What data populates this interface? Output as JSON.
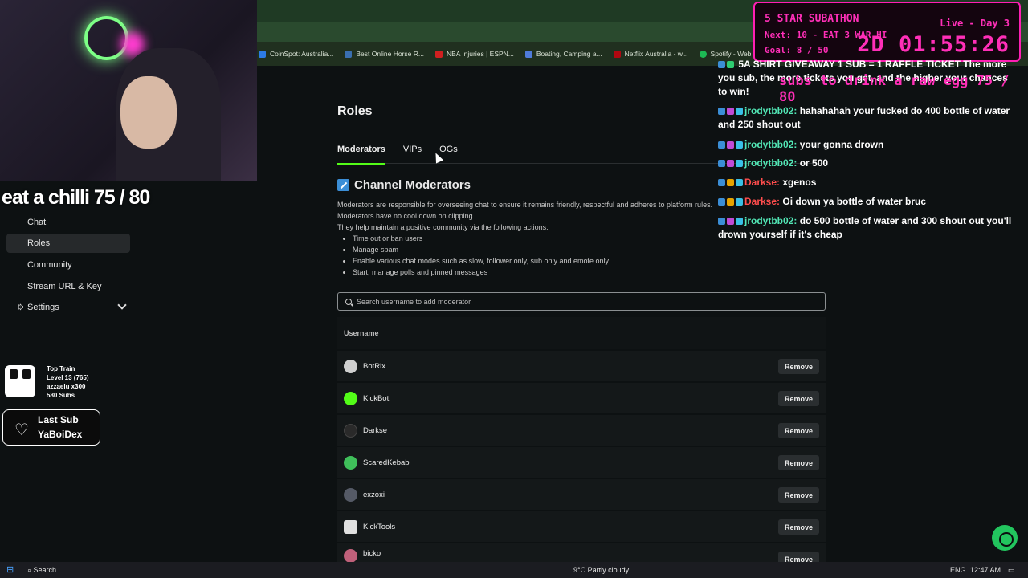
{
  "bookmarks": [
    "CoinSpot: Australia...",
    "Best Online Horse R...",
    "NBA Injuries | ESPN...",
    "Boating, Camping a...",
    "Netflix Australia - w...",
    "Spotify - Web Playe..."
  ],
  "sidebar": {
    "items": [
      {
        "label": "Chat",
        "icon": "none",
        "active": false
      },
      {
        "label": "Roles",
        "icon": "none",
        "active": true
      },
      {
        "label": "Community",
        "icon": "none",
        "active": false
      },
      {
        "label": "Stream URL & Key",
        "icon": "none",
        "active": false
      },
      {
        "label": "Settings",
        "icon": "gear-icon",
        "active": false
      }
    ]
  },
  "main": {
    "title": "Roles",
    "tabs": [
      "Moderators",
      "VIPs",
      "OGs"
    ],
    "active_tab": "Moderators",
    "section_title": "Channel Moderators",
    "desc_line1": "Moderators are responsible for overseeing chat to ensure it remains friendly, respectful and adheres to platform rules.",
    "desc_line2": "Moderators have no cool down on clipping.",
    "desc_line3": "They help maintain a positive community via the following actions:",
    "actions": [
      "Time out or ban users",
      "Manage spam",
      "Enable various chat modes such as slow, follower only, sub only and emote only",
      "Start, manage polls and pinned messages"
    ],
    "search_placeholder": "Search username to add moderator",
    "column_header": "Username",
    "remove_label": "Remove",
    "moderators": [
      {
        "name": "BotRix",
        "color": "#cfcfcf"
      },
      {
        "name": "KickBot",
        "color": "#53fc18"
      },
      {
        "name": "Darkse",
        "color": "#2a2a2a"
      },
      {
        "name": "ScaredKebab",
        "color": "#3fbf5a"
      },
      {
        "name": "exzoxi",
        "color": "#555a66"
      },
      {
        "name": "KickTools",
        "color": "#e0e0e0"
      },
      {
        "name": "bicko",
        "color": "#c0607a"
      }
    ]
  },
  "overlay": {
    "goal_text": "eat a chilli  75 / 80",
    "toptrain": {
      "line1": "Top Train",
      "line2": "Level 13  (765)",
      "line3": "azzaelu x300",
      "line4": "580 Subs"
    },
    "lastsub": {
      "line1": "Last Sub",
      "line2": "YaBoiDex"
    },
    "subathon": {
      "title": "5 STAR SUBATHON",
      "next": "Next: 10 - EAT 3 WAR HI",
      "goal": "Goal: 8 / 50",
      "live": "Live - Day 3",
      "timer": "2D  01:55:26"
    },
    "raw_egg": "subs to drink a raw egg  75 / 80"
  },
  "chat": [
    {
      "user": "",
      "text": "5A SHIRT GIVEAWAY  1 SUB = 1 RAFFLE TICKET  The more you sub, the more tickets you get, and the higher your chances to win!"
    },
    {
      "user": "jrodytbb02:",
      "text": "hahahahah your fucked do 400 bottle of water and 250 shout out"
    },
    {
      "user": "jrodytbb02:",
      "text": "your gonna drown"
    },
    {
      "user": "jrodytbb02:",
      "text": "or 500"
    },
    {
      "user": "Darkse:",
      "text": "xgenos"
    },
    {
      "user": "Darkse:",
      "text": "Oi down ya bottle of water bruc"
    },
    {
      "user": "jrodytbb02:",
      "text": "do 500 bottle of water and 300 shout out you'll drown yourself if it's cheap"
    }
  ],
  "taskbar": {
    "search": "Search",
    "weather": "9°C  Partly cloudy",
    "lang": "ENG",
    "time": "12:47 AM"
  },
  "colors": {
    "accent": "#53fc18",
    "overlay_pink": "#ff2fb8"
  }
}
